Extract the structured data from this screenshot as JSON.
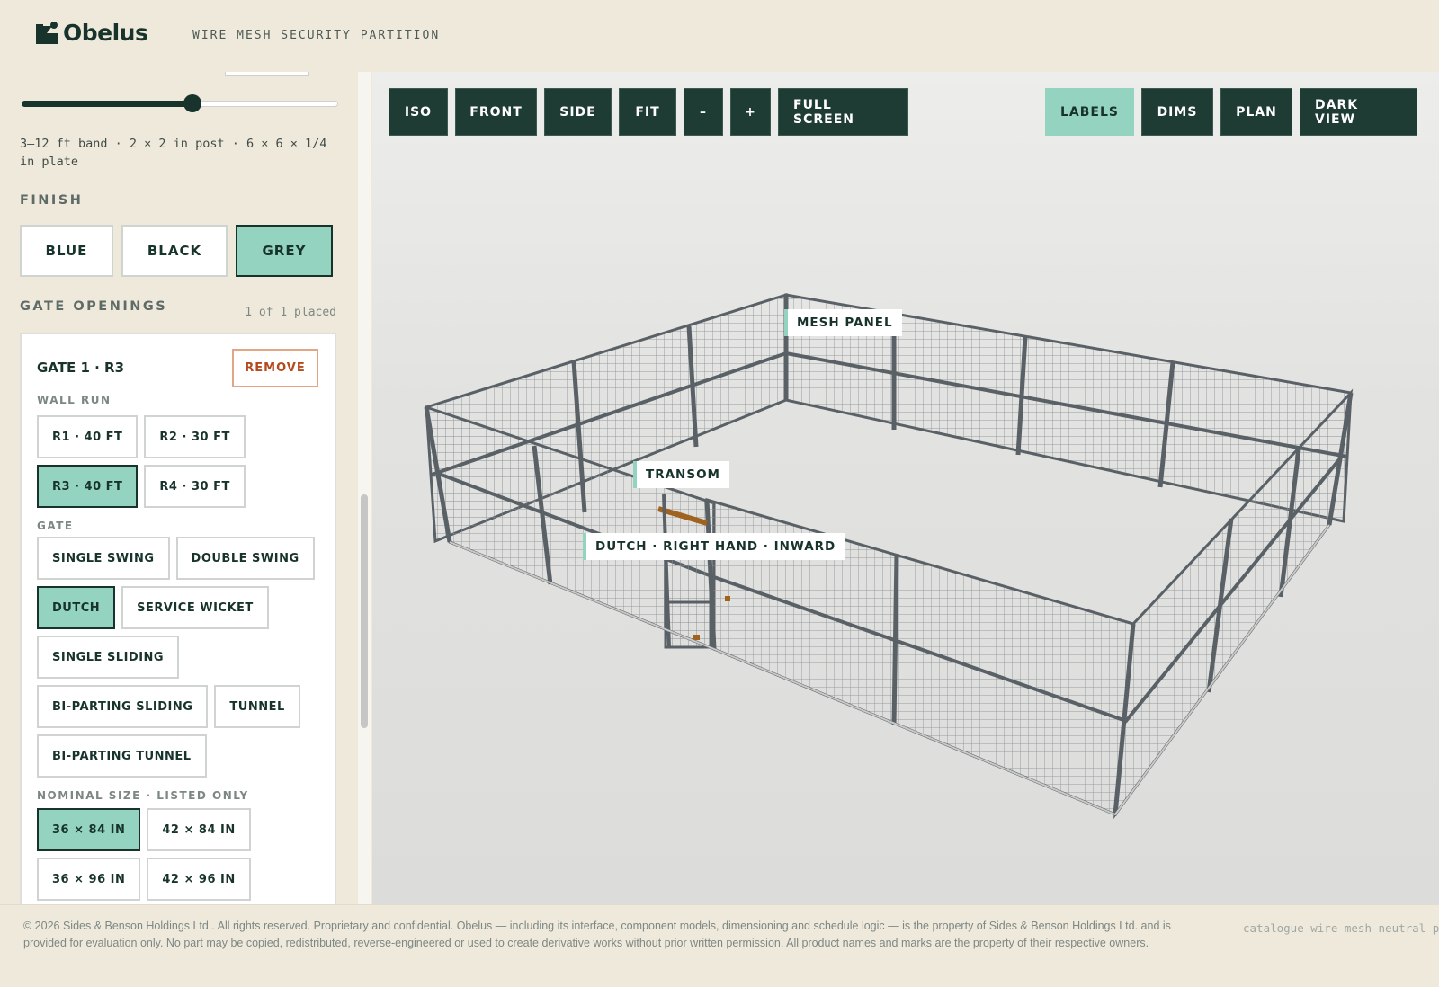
{
  "app": {
    "name": "Obelus",
    "subtitle": "WIRE MESH SECURITY PARTITION"
  },
  "sidebar": {
    "height_slider": {
      "value_fraction": 0.54
    },
    "spec_text": "3–12 ft band · 2 × 2 in post · 6 × 6 × 1/4 in plate",
    "finish": {
      "title": "FINISH",
      "options": [
        "BLUE",
        "BLACK",
        "GREY"
      ],
      "selected": "GREY"
    },
    "gate_openings": {
      "title": "GATE OPENINGS",
      "count_text": "1 of 1 placed",
      "card": {
        "title": "GATE 1 · R3",
        "remove_label": "REMOVE",
        "wall_run_label": "WALL RUN",
        "wall_runs": [
          "R1 · 40 FT",
          "R2 · 30 FT",
          "R3 · 40 FT",
          "R4 · 30 FT"
        ],
        "wall_run_selected": "R3 · 40 FT",
        "gate_label": "GATE",
        "gates": [
          "SINGLE SWING",
          "DOUBLE SWING",
          "DUTCH",
          "SERVICE WICKET",
          "SINGLE SLIDING",
          "BI-PARTING SLIDING",
          "TUNNEL",
          "BI-PARTING TUNNEL"
        ],
        "gate_selected": "DUTCH",
        "size_label": "NOMINAL SIZE · LISTED ONLY",
        "sizes": [
          "36 × 84 IN",
          "42 × 84 IN",
          "36 × 96 IN",
          "42 × 96 IN"
        ],
        "size_selected": "36 × 84 IN"
      }
    }
  },
  "viewport": {
    "toolbar_left": [
      "ISO",
      "FRONT",
      "SIDE",
      "FIT",
      "–",
      "+",
      "FULL SCREEN"
    ],
    "toolbar_right": [
      "LABELS",
      "DIMS",
      "PLAN",
      "DARK VIEW"
    ],
    "toolbar_active": "LABELS",
    "labels": {
      "mesh_panel": "MESH PANEL",
      "transom": "TRANSOM",
      "gate": "DUTCH · RIGHT HAND · INWARD"
    },
    "colors": {
      "frame": "#5a6166",
      "mesh": "#8a9094",
      "accent": "#93d3bf",
      "toolbar_dark": "#1f3c34",
      "transom": "#a0621f"
    }
  },
  "footer": {
    "legal": "© 2026 Sides & Benson Holdings Ltd.. All rights reserved. Proprietary and confidential. Obelus — including its interface, component models, dimensioning and schedule logic — is the property of Sides & Benson Holdings Ltd. and is provided for evaluation only. No part may be copied, redistributed, reverse-engineered or used to create derivative works without prior written permission. All product names and marks are the property of their respective owners.",
    "catalogue_code": "catalogue wire-mesh-neutral-p"
  }
}
